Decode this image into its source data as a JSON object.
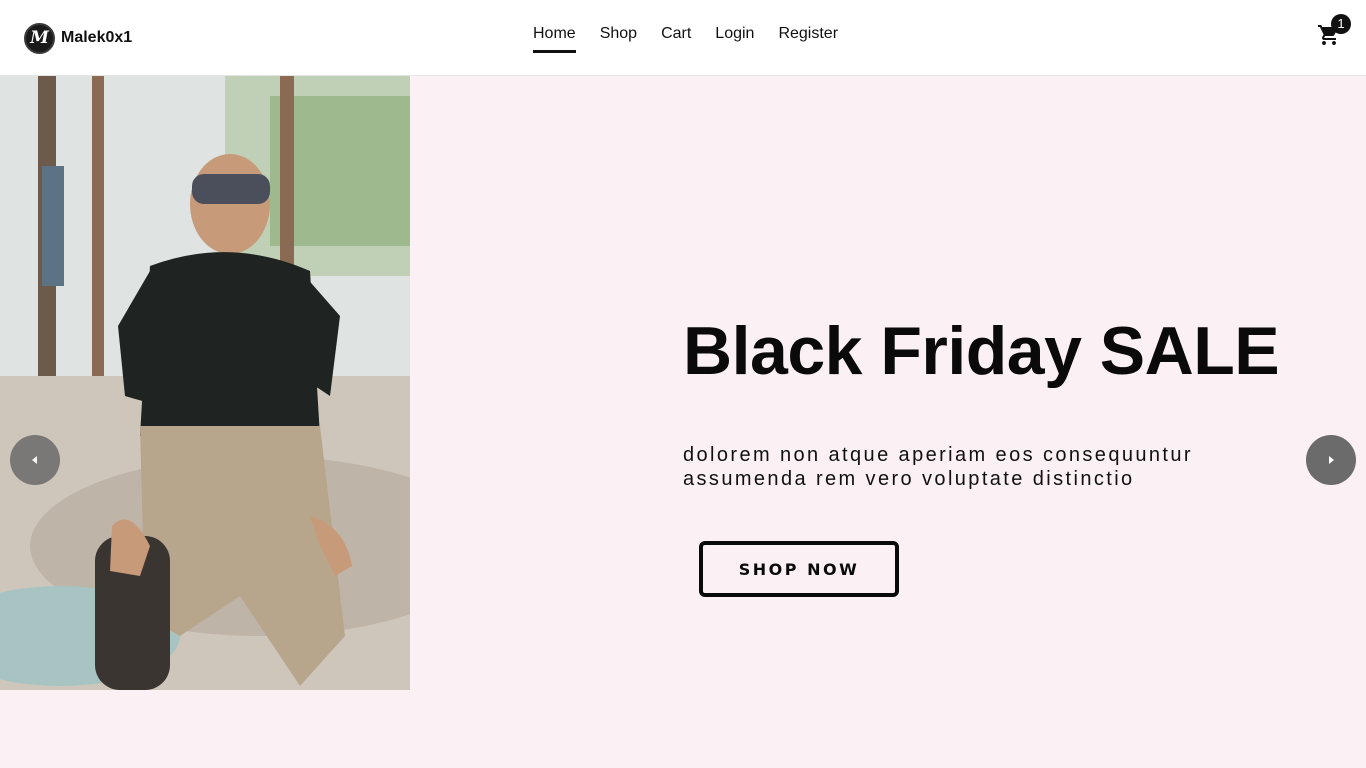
{
  "brand": {
    "name": "Malek0x1",
    "logo_letter": "M"
  },
  "nav": {
    "items": [
      {
        "label": "Home",
        "active": true
      },
      {
        "label": "Shop"
      },
      {
        "label": "Cart"
      },
      {
        "label": "Login"
      },
      {
        "label": "Register"
      }
    ]
  },
  "cart": {
    "icon": "cart-icon",
    "count": "1"
  },
  "hero": {
    "image": "skateboarder-photo",
    "title": "Black Friday SALE",
    "description": "dolorem non atque aperiam eos consequuntur assumenda rem vero voluptate distinctio",
    "cta_label": "SHOP NOW"
  },
  "carousel": {
    "prev_icon": "caret-left-icon",
    "next_icon": "caret-right-icon"
  },
  "colors": {
    "background": "#fbf0f4",
    "header": "#ffffff",
    "text": "#0a0a0a",
    "arrow": "#6b6b6b"
  }
}
